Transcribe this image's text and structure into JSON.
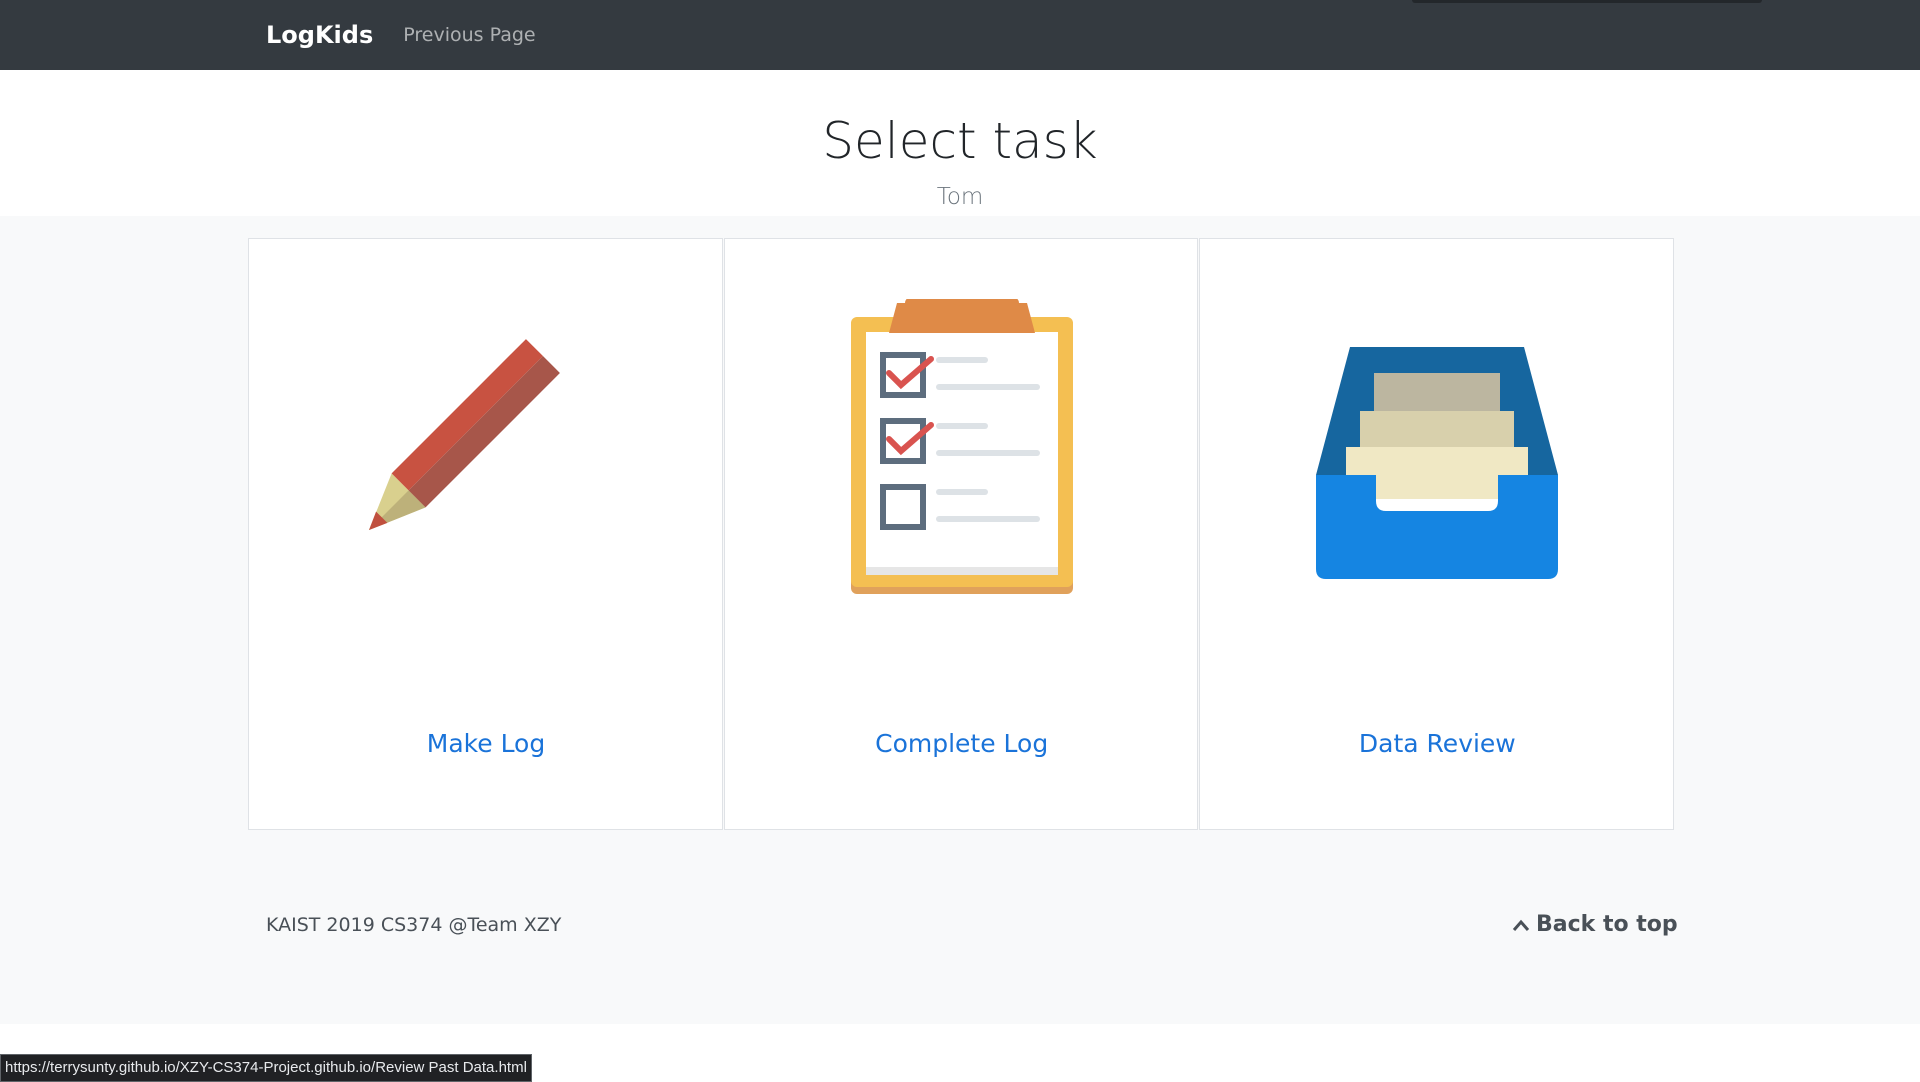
{
  "navbar": {
    "brand": "LogKids",
    "previous_link": "Previous Page"
  },
  "header": {
    "title": "Select task",
    "subtitle": "Tom"
  },
  "tasks": [
    {
      "label": "Make Log",
      "icon": "pencil-icon"
    },
    {
      "label": "Complete Log",
      "icon": "clipboard-checklist-icon"
    },
    {
      "label": "Data Review",
      "icon": "file-tray-icon"
    }
  ],
  "footer": {
    "credit": "KAIST 2019 CS374 @Team XZY",
    "back_to_top": "Back to top"
  },
  "status_bar": {
    "url": "https://terrysunty.github.io/XZY-CS374-Project.github.io/Review Past Data.html"
  },
  "colors": {
    "navbar": "#343a40",
    "link": "#1a73d9",
    "background": "#f8f9fa"
  }
}
